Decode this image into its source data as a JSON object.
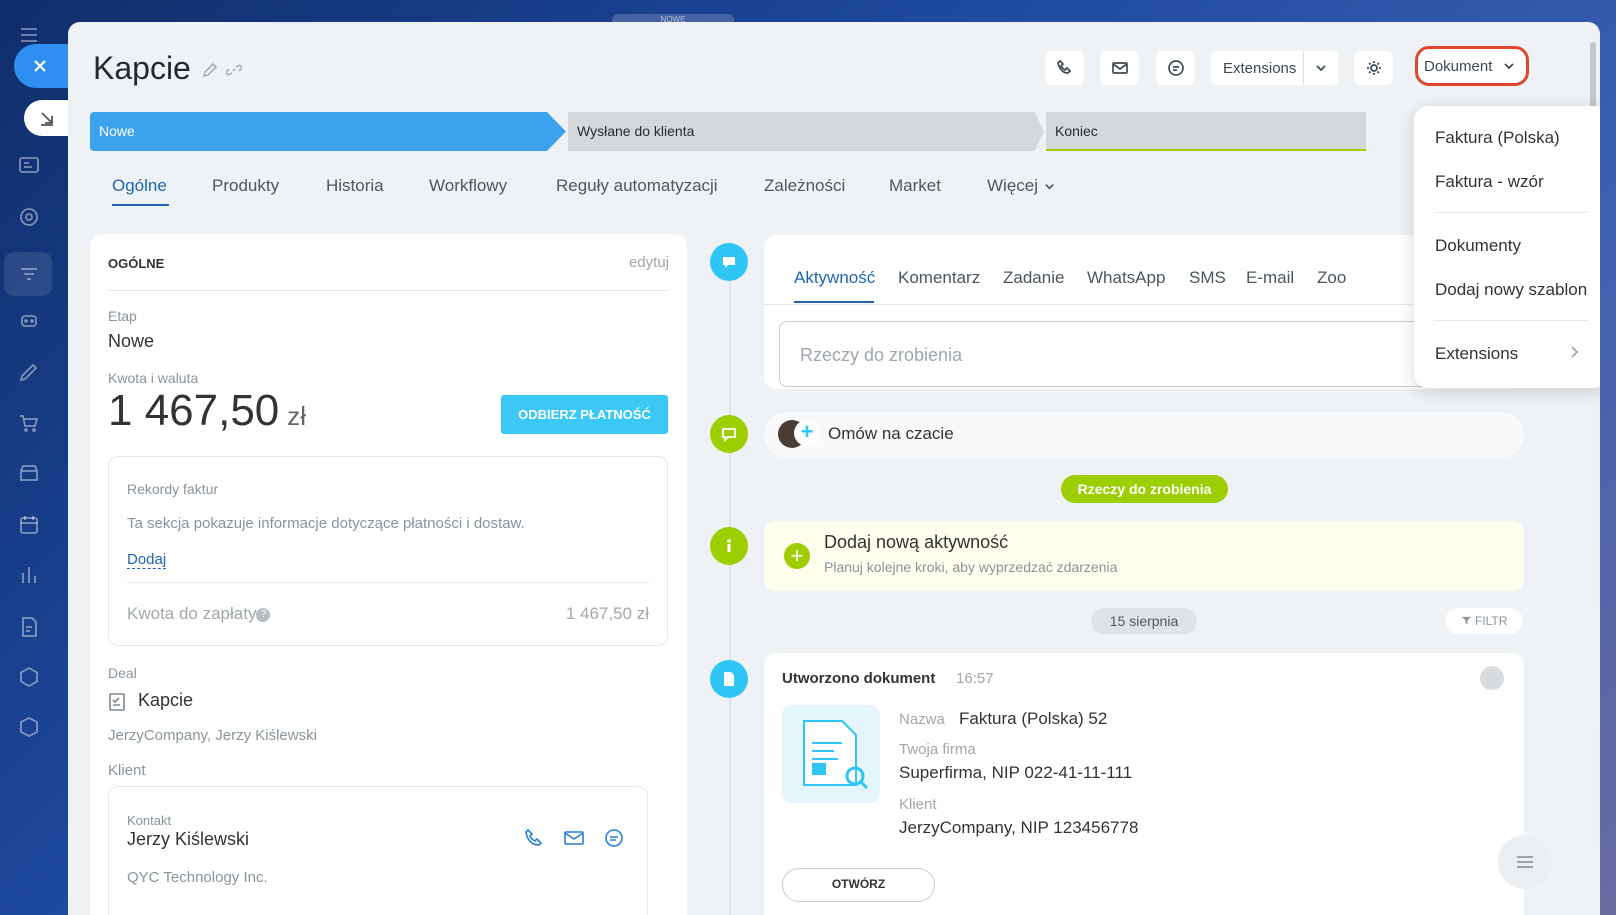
{
  "top_pill": "NOWE",
  "header": {
    "title": "Kapcie",
    "extensions_label": "Extensions",
    "document_label": "Dokument"
  },
  "stages": [
    "Nowe",
    "Wysłane do klienta",
    "Koniec"
  ],
  "tabs": [
    "Ogólne",
    "Produkty",
    "Historia",
    "Workflowy",
    "Reguły automatyzacji",
    "Zależności",
    "Market",
    "Więcej"
  ],
  "general": {
    "section_title": "OGÓLNE",
    "edit_label": "edytuj",
    "stage_label": "Etap",
    "stage_value": "Nowe",
    "amount_label": "Kwota i waluta",
    "amount_value": "1 467,50",
    "currency": "zł",
    "pay_button": "ODBIERZ PŁATNOŚĆ",
    "invoices_label": "Rekordy faktur",
    "invoices_text": "Ta sekcja pokazuje informacje dotyczące płatności i dostaw.",
    "add_label": "Dodaj",
    "due_label": "Kwota do zapłaty",
    "due_value": "1 467,50 zł",
    "deal_label": "Deal",
    "deal_name": "Kapcie",
    "deal_company": "JerzyCompany, Jerzy Kiślewski",
    "client_label": "Klient",
    "contact_label": "Kontakt",
    "contact_name": "Jerzy Kiślewski",
    "contact_company": "QYC Technology Inc."
  },
  "activity": {
    "tabs": [
      "Aktywność",
      "Komentarz",
      "Zadanie",
      "WhatsApp",
      "SMS",
      "E-mail",
      "Zoo"
    ],
    "todo_placeholder": "Rzeczy do zrobienia",
    "chat_text": "Omów na czacie",
    "todo_pill": "Rzeczy do zrobienia",
    "new_activity_title": "Dodaj nową aktywność",
    "new_activity_sub": "Planuj kolejne kroki, aby wyprzedzać zdarzenia",
    "date_pill": "15 sierpnia",
    "filter_label": "FILTR"
  },
  "document_event": {
    "title": "Utworzono dokument",
    "time": "16:57",
    "name_label": "Nazwa",
    "name_value": "Faktura (Polska) 52",
    "firm_label": "Twoja firma",
    "firm_value": "Superfirma, NIP 022-41-11-111",
    "client_label": "Klient",
    "client_value": "JerzyCompany, NIP 123456778",
    "open_button": "OTWÓRZ"
  },
  "menu": {
    "items": [
      "Faktura (Polska)",
      "Faktura - wzór",
      "Dokumenty",
      "Dodaj nowy szablon",
      "Extensions"
    ]
  },
  "colors": {
    "accent": "#2fc6f6",
    "stage_active": "#3da2ee",
    "highlight": "#e0462e",
    "green": "#9dcf00"
  }
}
